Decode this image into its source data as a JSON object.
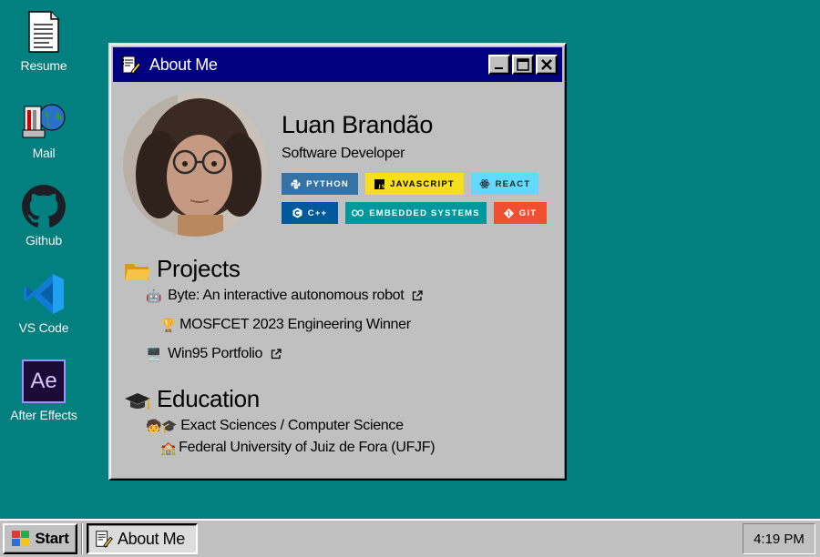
{
  "desktop": {
    "icons": [
      {
        "label": "Resume",
        "icon": "document-icon"
      },
      {
        "label": "Mail",
        "icon": "mail-icon"
      },
      {
        "label": "Github",
        "icon": "github-icon"
      },
      {
        "label": "VS Code",
        "icon": "vscode-icon"
      },
      {
        "label": "After Effects",
        "icon": "after-effects-icon"
      }
    ],
    "ae_text": "Ae"
  },
  "window": {
    "title": "About Me",
    "name": "Luan Brandão",
    "role": "Software Developer",
    "badges": [
      {
        "label": "PYTHON",
        "color": "#3572A5",
        "text_color": "#ffffff"
      },
      {
        "label": "JAVASCRIPT",
        "color": "#F7DF1E",
        "text_color": "#000000"
      },
      {
        "label": "REACT",
        "color": "#61DAFB",
        "text_color": "#20232a"
      },
      {
        "label": "C++",
        "color": "#00599C",
        "text_color": "#ffffff"
      },
      {
        "label": "EMBEDDED SYSTEMS",
        "color": "#00979D",
        "text_color": "#ffffff"
      },
      {
        "label": "GIT",
        "color": "#F05032",
        "text_color": "#ffffff"
      }
    ],
    "projects": {
      "heading": "Projects",
      "items": [
        {
          "emoji": "🤖",
          "text": "Byte: An interactive autonomous robot",
          "link": true
        },
        {
          "emoji": "🏆",
          "text": "MOSFCET 2023 Engineering Winner",
          "link": false
        },
        {
          "emoji": "🖥️",
          "text": "Win95 Portfolio",
          "link": true
        }
      ]
    },
    "education": {
      "heading": "Education",
      "degree": "Exact Sciences / Computer Science",
      "degree_emoji": "🧒🎓",
      "school": "Federal University of Juiz de Fora (UFJF)",
      "school_emoji": "🏫"
    }
  },
  "taskbar": {
    "start_label": "Start",
    "task_label": "About Me",
    "clock": "4:19 PM"
  },
  "colors": {
    "desktop": "#028080",
    "titlebar": "#000080",
    "window": "#c0c0c0"
  }
}
